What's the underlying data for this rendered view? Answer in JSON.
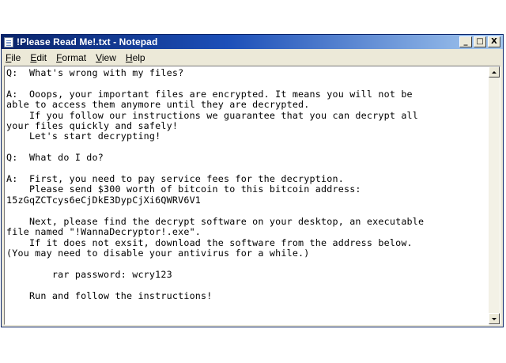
{
  "window": {
    "title": "!Please Read Me!.txt - Notepad",
    "buttons": {
      "minimize": "_",
      "maximize": "□",
      "close": "X"
    }
  },
  "menu": [
    "File",
    "Edit",
    "Format",
    "View",
    "Help"
  ],
  "document": {
    "text": "Q:  What's wrong with my files?\n\nA:  Ooops, your important files are encrypted. It means you will not be\nable to access them anymore until they are decrypted.\n    If you follow our instructions we guarantee that you can decrypt all\nyour files quickly and safely!\n    Let's start decrypting!\n\nQ:  What do I do?\n\nA:  First, you need to pay service fees for the decryption.\n    Please send $300 worth of bitcoin to this bitcoin address:\n15zGqZCTcys6eCjDkE3DypCjXi6QWRV6V1\n\n    Next, please find the decrypt software on your desktop, an executable\nfile named \"!WannaDecryptor!.exe\".\n    If it does not exsit, download the software from the address below.\n(You may need to disable your antivirus for a while.)\n\n        rar password: wcry123\n\n    Run and follow the instructions!"
  }
}
